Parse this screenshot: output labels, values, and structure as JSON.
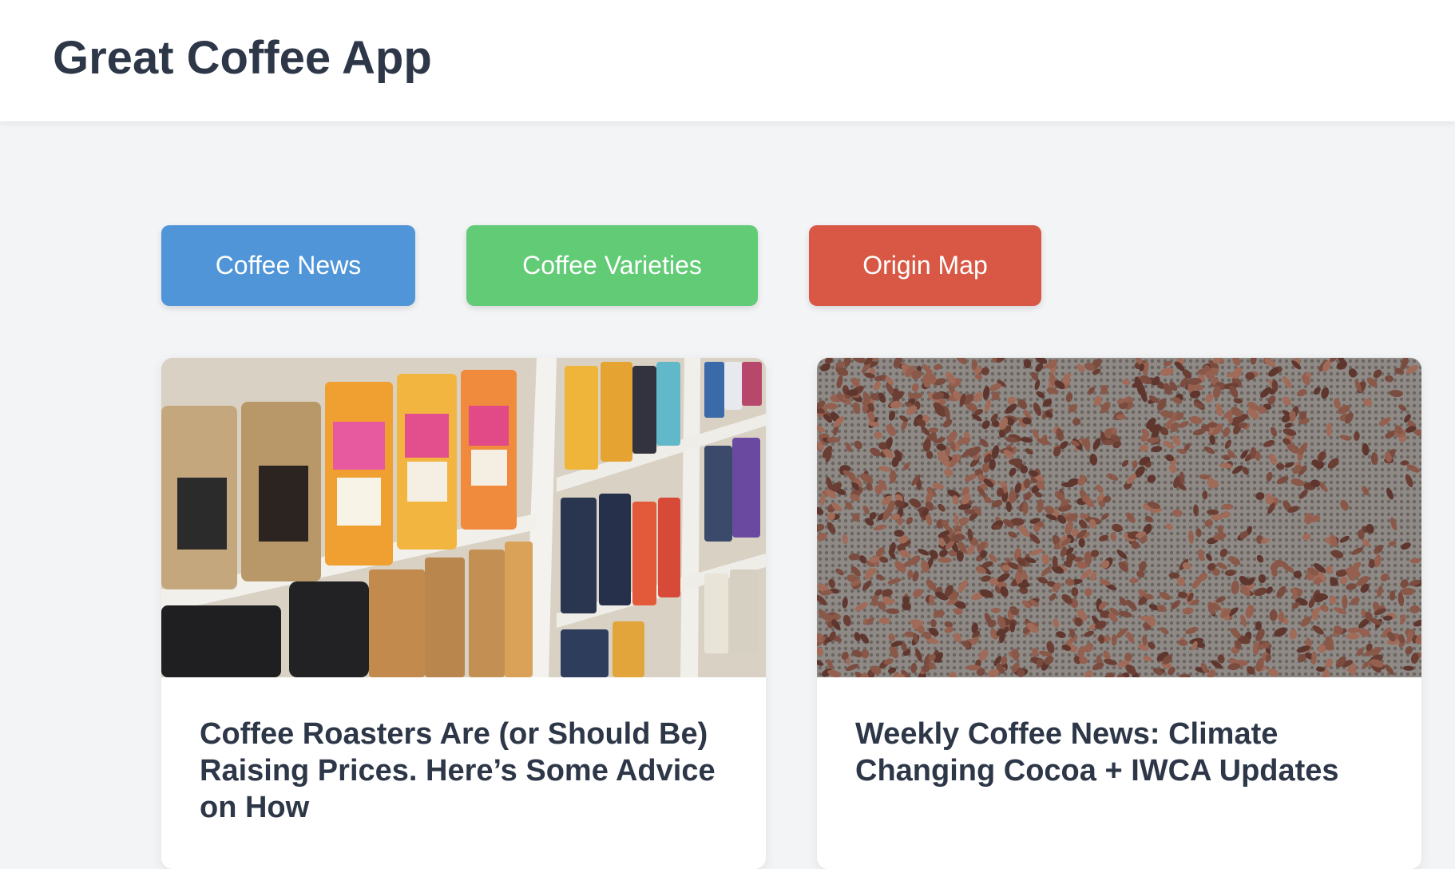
{
  "app": {
    "title": "Great Coffee App"
  },
  "nav": {
    "buttons": [
      {
        "label": "Coffee News",
        "color": "#4f95d8"
      },
      {
        "label": "Coffee Varieties",
        "color": "#62cb76"
      },
      {
        "label": "Origin Map",
        "color": "#d95845"
      }
    ]
  },
  "articles": [
    {
      "title": "Coffee Roasters Are (or Should Be) Raising Prices. Here’s Some Advice on How",
      "image": "coffee-bags-shelf-photo"
    },
    {
      "title": "Weekly Coffee News: Climate Changing Cocoa + IWCA Updates",
      "image": "cocoa-beans-drying-photo"
    }
  ],
  "colors": {
    "background": "#f3f4f6",
    "header_bg": "#ffffff",
    "text_dark": "#2d3748"
  }
}
